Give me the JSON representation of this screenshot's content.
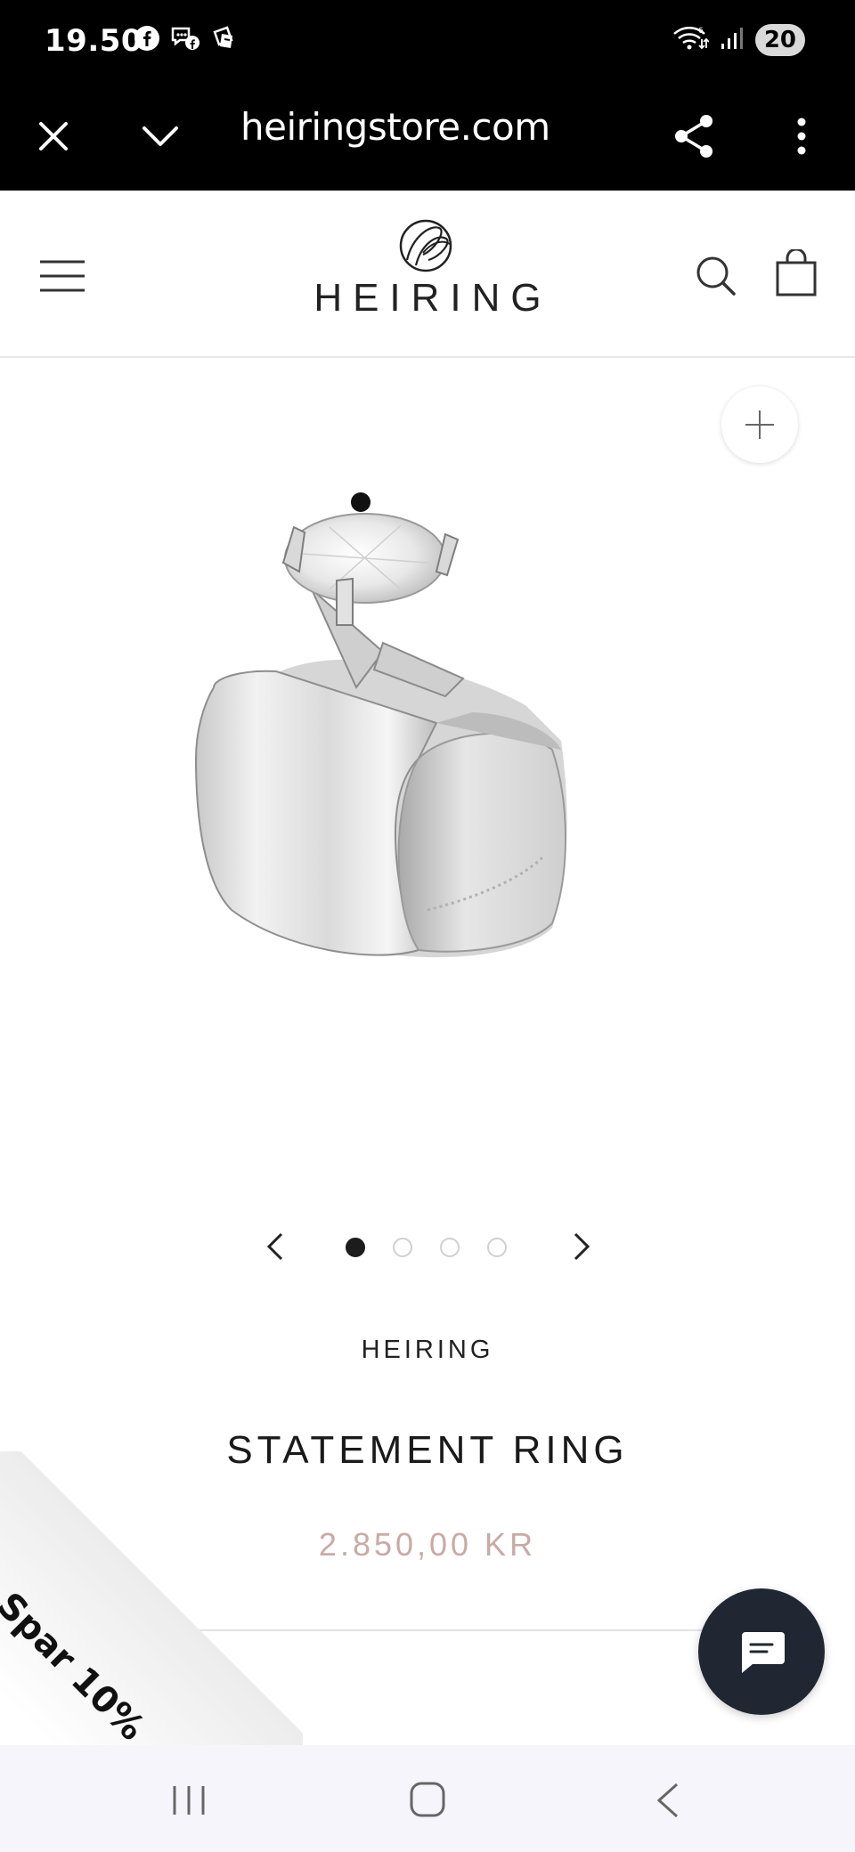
{
  "status_bar": {
    "time": "19.50",
    "battery": "20",
    "icons": [
      "facebook-icon",
      "messenger-icon",
      "notification-app-icon",
      "wifi-icon",
      "signal-icon"
    ]
  },
  "browser": {
    "url": "heiringstore.com",
    "icons": [
      "close-icon",
      "chevron-down-icon",
      "share-icon",
      "more-vert-icon"
    ]
  },
  "header": {
    "logo_text": "HEIRING",
    "icons": [
      "hamburger-menu-icon",
      "search-icon",
      "shopping-bag-icon"
    ]
  },
  "gallery": {
    "total_images": 4,
    "active_index": 0,
    "icons": [
      "zoom-plus-icon",
      "chevron-left-icon",
      "chevron-right-icon"
    ]
  },
  "product": {
    "brand": "HEIRING",
    "title": "STATEMENT RING",
    "price": "2.850,00 KR"
  },
  "promo": {
    "label": "Spar 10%"
  },
  "chat": {
    "icon": "chat-bubble-icon"
  },
  "nav": {
    "icons": [
      "recent-apps-icon",
      "home-icon",
      "back-icon"
    ]
  },
  "colors": {
    "price": "#c9aaa6",
    "chat_button": "#202732",
    "status_bar": "#000000",
    "nav_bar": "#f6f5fc"
  }
}
